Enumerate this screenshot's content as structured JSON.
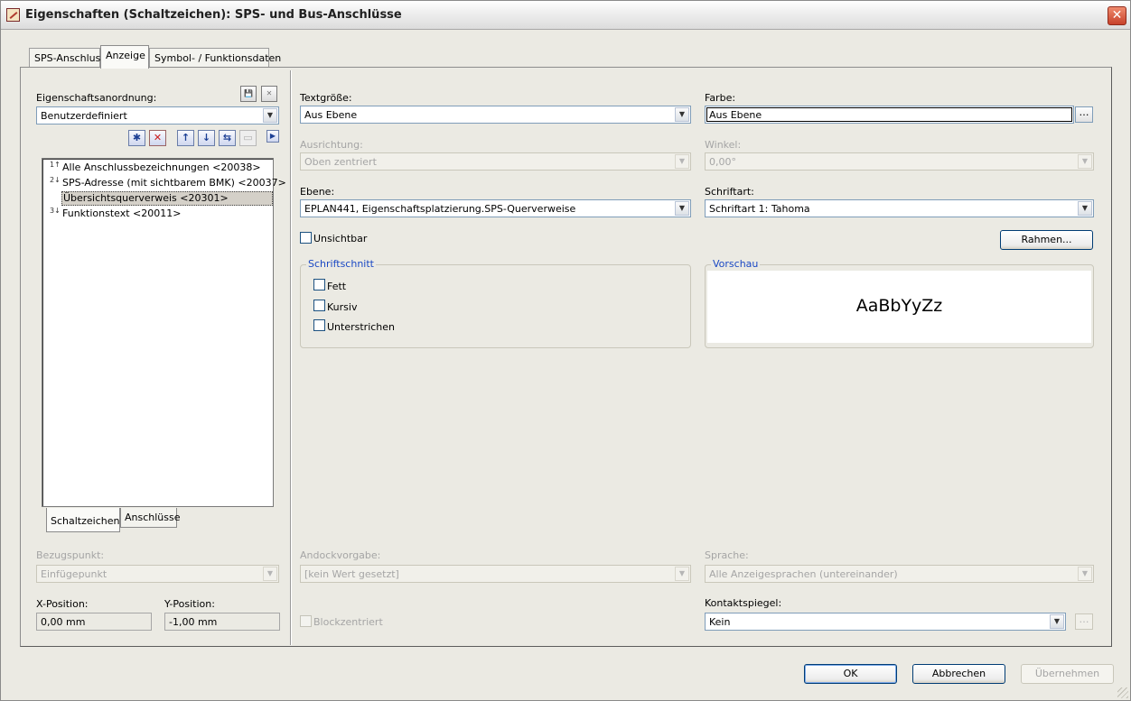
{
  "window": {
    "title": "Eigenschaften (Schaltzeichen): SPS- und Bus-Anschlüsse"
  },
  "tabs": [
    {
      "label": "SPS-Anschluss",
      "active": false
    },
    {
      "label": "Anzeige",
      "active": true
    },
    {
      "label": "Symbol- / Funktionsdaten",
      "active": false
    }
  ],
  "left": {
    "arrangement_label": "Eigenschaftsanordnung:",
    "arrangement_value": "Benutzerdefiniert",
    "items": [
      {
        "label": "Alle Anschlussbezeichnungen <20038>",
        "order": "1↑"
      },
      {
        "label": "SPS-Adresse (mit sichtbarem BMK) <20037>",
        "order": "2↓"
      },
      {
        "label": "Übersichtsquerverweis <20301>",
        "order": ""
      },
      {
        "label": "Funktionstext <20011>",
        "order": "3↓"
      }
    ],
    "subtabs": [
      "Schaltzeichen",
      "Anschlüsse"
    ],
    "bezugspunkt_label": "Bezugspunkt:",
    "bezugspunkt_value": "Einfügepunkt",
    "xpos_label": "X-Position:",
    "xpos_value": "0,00 mm",
    "ypos_label": "Y-Position:",
    "ypos_value": "-1,00 mm"
  },
  "right": {
    "textgroesse_label": "Textgröße:",
    "textgroesse_value": "Aus Ebene",
    "farbe_label": "Farbe:",
    "farbe_value": "Aus Ebene",
    "ausrichtung_label": "Ausrichtung:",
    "ausrichtung_value": "Oben zentriert",
    "winkel_label": "Winkel:",
    "winkel_value": "0,00°",
    "ebene_label": "Ebene:",
    "ebene_value": "EPLAN441, Eigenschaftsplatzierung.SPS-Querverweise",
    "schriftart_label": "Schriftart:",
    "schriftart_value": "Schriftart 1: Tahoma",
    "unsichtbar_label": "Unsichtbar",
    "rahmen_label": "Rahmen...",
    "schriftschnitt_title": "Schriftschnitt",
    "fett_label": "Fett",
    "kursiv_label": "Kursiv",
    "unterstrichen_label": "Unterstrichen",
    "vorschau_title": "Vorschau",
    "vorschau_text": "AaBbYyZz",
    "andock_label": "Andockvorgabe:",
    "andock_value": "[kein Wert gesetzt]",
    "sprache_label": "Sprache:",
    "sprache_value": "Alle Anzeigesprachen (untereinander)",
    "blockzentriert_label": "Blockzentriert",
    "kontakt_label": "Kontaktspiegel:",
    "kontakt_value": "Kein"
  },
  "footer": {
    "ok_label": "OK",
    "cancel_label": "Abbrechen",
    "apply_label": "Übernehmen"
  }
}
